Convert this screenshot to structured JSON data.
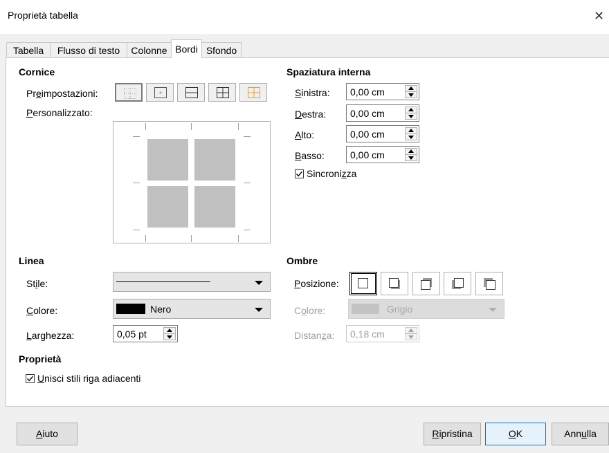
{
  "window": {
    "title": "Proprietà tabella",
    "close_glyph": "✕"
  },
  "tabs": [
    {
      "label": "Tabella"
    },
    {
      "label": "Flusso di testo"
    },
    {
      "label": "Colonne"
    },
    {
      "label": "Bordi",
      "active": true
    },
    {
      "label": "Sfondo"
    }
  ],
  "cornice": {
    "heading": "Cornice",
    "preset_label_pre": "Pr",
    "preset_label_mn": "e",
    "preset_label_post": "impostazioni:",
    "custom_label_mn": "P",
    "custom_label_post": "ersonalizzato:",
    "preset_icons": [
      "border-none-icon",
      "border-inner-only-icon",
      "border-outer-horizontal-icon",
      "border-all-icon",
      "border-outer-inner-icon"
    ]
  },
  "spaziatura": {
    "heading": "Spaziatura interna",
    "sinistra": {
      "mn": "S",
      "rest": "inistra:",
      "value": "0,00 cm"
    },
    "destra": {
      "mn": "D",
      "rest": "estra:",
      "value": "0,00 cm"
    },
    "alto": {
      "mn": "A",
      "rest": "lto:",
      "value": "0,00 cm"
    },
    "basso": {
      "mn": "B",
      "rest": "asso:",
      "value": "0,00 cm"
    },
    "sync": {
      "pre": "Sincroni",
      "mn": "z",
      "post": "za",
      "checked": true
    }
  },
  "linea": {
    "heading": "Linea",
    "stile": {
      "pre": "St",
      "mn": "i",
      "post": "le:"
    },
    "colore": {
      "mn": "C",
      "post": "olore:",
      "value": "Nero",
      "swatch": "#000000"
    },
    "larghezza": {
      "mn": "L",
      "post": "arghezza:",
      "value": "0,05 pt"
    }
  },
  "ombre": {
    "heading": "Ombre",
    "posizione": {
      "mn": "P",
      "post": "osizione:"
    },
    "colore": {
      "pre": "C",
      "mn": "o",
      "post": "lore:",
      "value": "Grigio",
      "swatch": "#c0c0c0"
    },
    "distanza": {
      "pre": "Distan",
      "mn": "z",
      "post": "a:",
      "value": "0,18 cm"
    },
    "position_icons": [
      "shadow-none-icon",
      "shadow-bottom-right-icon",
      "shadow-top-right-icon",
      "shadow-bottom-left-icon",
      "shadow-top-left-icon"
    ]
  },
  "proprieta": {
    "heading": "Proprietà",
    "merge": {
      "mn": "U",
      "post": "nisci stili riga adiacenti",
      "checked": true
    }
  },
  "buttons": {
    "aiuto": {
      "mn": "A",
      "post": "iuto"
    },
    "ripristina": {
      "mn": "R",
      "post": "ipristina"
    },
    "ok": {
      "mn": "O",
      "post": "K"
    },
    "annulla": {
      "pre": "Ann",
      "mn": "u",
      "post": "lla"
    }
  },
  "colors": {
    "accent": "#0078d7",
    "preset_orange": "#f0a030"
  }
}
